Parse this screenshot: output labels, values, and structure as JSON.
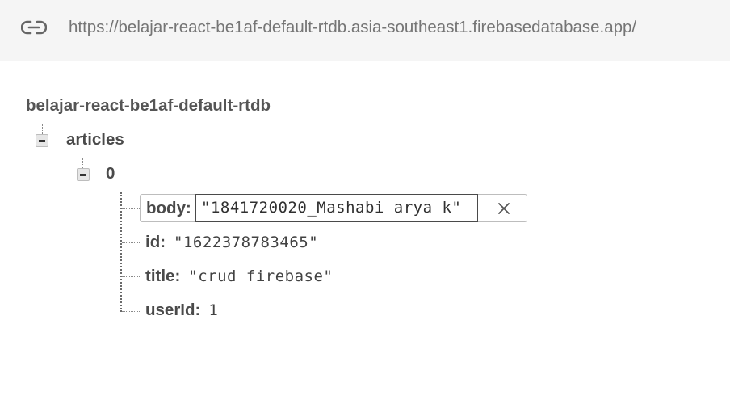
{
  "header": {
    "url": "https://belajar-react-be1af-default-rtdb.asia-southeast1.firebasedatabase.app/",
    "icon": "link-icon"
  },
  "tree": {
    "root": "belajar-react-be1af-default-rtdb",
    "articles": {
      "label": "articles",
      "expanded": true,
      "child": {
        "label": "0",
        "expanded": true,
        "fields": {
          "body": {
            "key": "body:",
            "value": "\"1841720020_Mashabi arya k\"",
            "editing": true
          },
          "id": {
            "key": "id:",
            "value": "\"1622378783465\""
          },
          "title": {
            "key": "title:",
            "value": "\"crud firebase\""
          },
          "userId": {
            "key": "userId:",
            "value": "1"
          }
        }
      }
    }
  },
  "icons": {
    "collapse": "minus-icon",
    "clear": "close-icon"
  },
  "colors": {
    "header_bg": "#f5f5f5",
    "text": "#4a4a4a",
    "url_text": "#757575"
  }
}
